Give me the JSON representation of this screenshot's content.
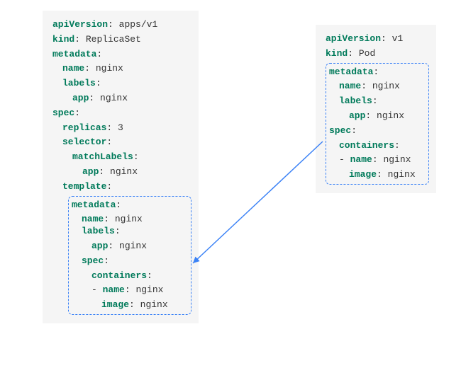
{
  "left": {
    "apiVersion_k": "apiVersion",
    "apiVersion_v": "apps/v1",
    "kind_k": "kind",
    "kind_v": "ReplicaSet",
    "metadata_k": "metadata",
    "name_k": "name",
    "name_v": "nginx",
    "labels_k": "labels",
    "app_k": "app",
    "app_v": "nginx",
    "spec_k": "spec",
    "replicas_k": "replicas",
    "replicas_v": "3",
    "selector_k": "selector",
    "matchLabels_k": "matchLabels",
    "template_k": "template",
    "tpl": {
      "metadata_k": "metadata",
      "name_k": "name",
      "name_v": "nginx",
      "labels_k": "labels",
      "app_k": "app",
      "app_v": "nginx",
      "spec_k": "spec",
      "containers_k": "containers",
      "dash": "- ",
      "cname_k": "name",
      "cname_v": "nginx",
      "image_k": "image",
      "image_v": "nginx"
    }
  },
  "right": {
    "apiVersion_k": "apiVersion",
    "apiVersion_v": "v1",
    "kind_k": "kind",
    "kind_v": "Pod",
    "metadata_k": "metadata",
    "name_k": "name",
    "name_v": "nginx",
    "labels_k": "labels",
    "app_k": "app",
    "app_v": "nginx",
    "spec_k": "spec",
    "containers_k": "containers",
    "dash": "- ",
    "cname_k": "name",
    "cname_v": "nginx",
    "image_k": "image",
    "image_v": "nginx"
  },
  "colon": ":"
}
